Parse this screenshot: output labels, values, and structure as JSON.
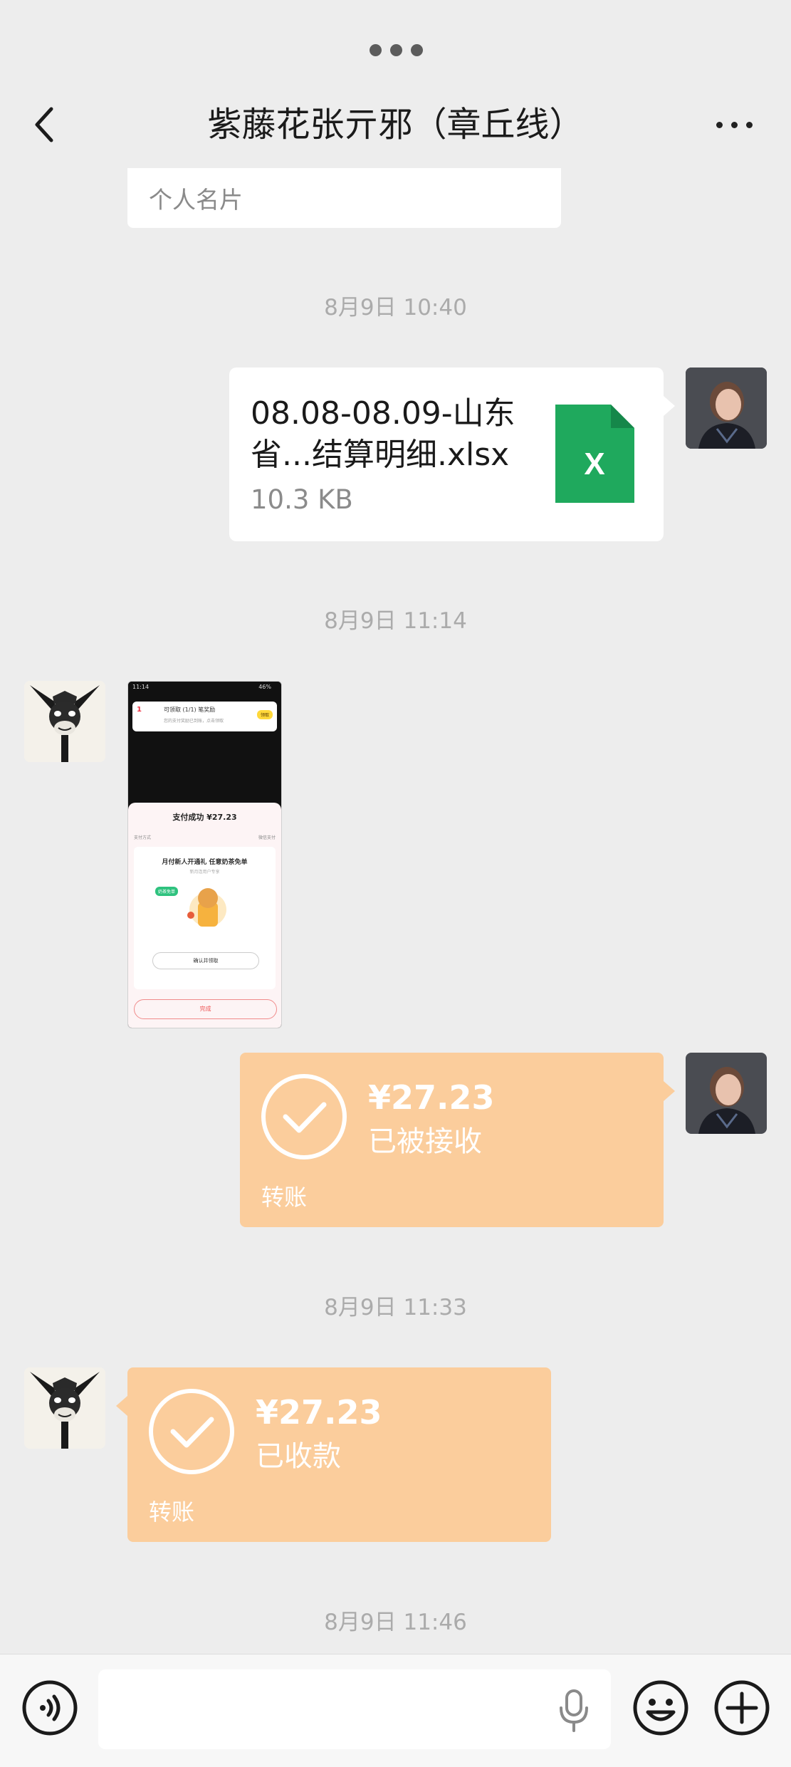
{
  "header": {
    "title": "紫藤花张亓邪（章丘线）"
  },
  "messages": {
    "namecard_label": "个人名片",
    "ts1": "8月9日 10:40",
    "file": {
      "name": "08.08-08.09-山东省...结算明细.xlsx",
      "size": "10.3 KB",
      "icon_letter": "X"
    },
    "ts2": "8月9日 11:14",
    "thumbnail": {
      "time": "11:14",
      "battery": "46%",
      "notice_title": "可领取 (1/1) 笔奖励",
      "notice_sub": "您的支付奖励已到账，点击领取",
      "notice_btn": "领取",
      "sheet_title": "支付成功 ¥27.23",
      "sheet_left": "支付方式",
      "sheet_right": "微信支付",
      "promo_title": "月付新人开通礼 任意奶茶免单",
      "promo_sub": "新月连用户专享",
      "promo_tag": "奶茶免单",
      "confirm_btn": "确认并领取",
      "done_btn": "完成"
    },
    "transfer_sent": {
      "amount": "¥27.23",
      "status": "已被接收",
      "label": "转账"
    },
    "ts3": "8月9日 11:33",
    "transfer_received": {
      "amount": "¥27.23",
      "status": "已收款",
      "label": "转账"
    },
    "ts4": "8月9日 11:46"
  },
  "colors": {
    "background": "#ededed",
    "transfer_bubble": "#fbcd9c",
    "excel_green": "#1fa95d"
  },
  "icons": {
    "back": "chevron-left-icon",
    "more": "more-dots-icon",
    "voice": "voice-mode-icon",
    "mic": "microphone-icon",
    "emoji": "emoji-icon",
    "plus": "plus-icon"
  }
}
